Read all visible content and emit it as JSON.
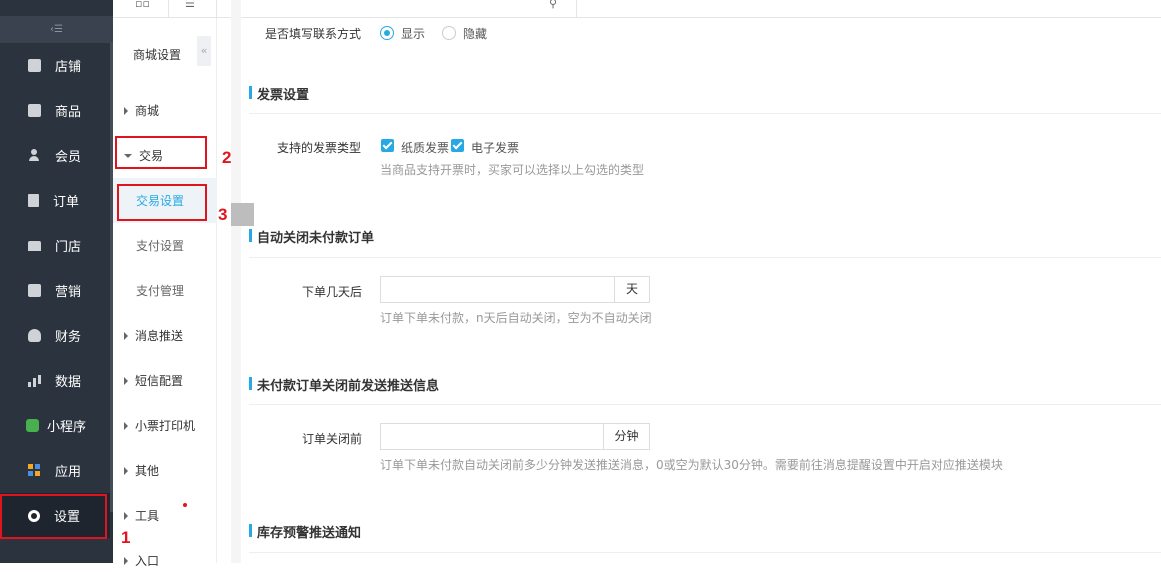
{
  "sidebar": {
    "collapse_icon": "menu-collapse-icon",
    "items": [
      {
        "label": "店铺",
        "icon": "store-icon"
      },
      {
        "label": "商品",
        "icon": "goods-icon"
      },
      {
        "label": "会员",
        "icon": "member-icon"
      },
      {
        "label": "订单",
        "icon": "order-icon"
      },
      {
        "label": "门店",
        "icon": "shop-icon"
      },
      {
        "label": "营销",
        "icon": "gift-icon"
      },
      {
        "label": "财务",
        "icon": "money-bag-icon"
      },
      {
        "label": "数据",
        "icon": "bar-chart-icon"
      },
      {
        "label": "小程序",
        "icon": "mini-program-icon"
      },
      {
        "label": "应用",
        "icon": "apps-grid-icon"
      },
      {
        "label": "设置",
        "icon": "gear-icon",
        "active": true
      }
    ]
  },
  "submenu": {
    "title": "商城设置",
    "fold_icon": "«",
    "items": [
      {
        "label": "商城",
        "type": "group"
      },
      {
        "label": "交易",
        "type": "group",
        "expanded": true
      },
      {
        "label": "交易设置",
        "type": "child",
        "selected": true
      },
      {
        "label": "支付设置",
        "type": "child"
      },
      {
        "label": "支付管理",
        "type": "child"
      },
      {
        "label": "消息推送",
        "type": "group"
      },
      {
        "label": "短信配置",
        "type": "group"
      },
      {
        "label": "小票打印机",
        "type": "group"
      },
      {
        "label": "其他",
        "type": "group"
      },
      {
        "label": "工具",
        "type": "group"
      },
      {
        "label": "入口",
        "type": "group"
      }
    ]
  },
  "annotations": [
    "1",
    "2",
    "3"
  ],
  "content": {
    "contact_row": {
      "label": "是否填写联系方式",
      "options": [
        "显示",
        "隐藏"
      ],
      "selected": "显示"
    },
    "invoice": {
      "title": "发票设置",
      "label": "支持的发票类型",
      "options": [
        "纸质发票",
        "电子发票"
      ],
      "hint": "当商品支持开票时，买家可以选择以上勾选的类型"
    },
    "auto_close": {
      "title": "自动关闭未付款订单",
      "label": "下单几天后",
      "value": "",
      "unit": "天",
      "hint": "订单下单未付款，n天后自动关闭，空为不自动关闭"
    },
    "close_notice": {
      "title": "未付款订单关闭前发送推送信息",
      "label": "订单关闭前",
      "value": "",
      "unit": "分钟",
      "hint": "订单下单未付款自动关闭前多少分钟发送推送消息，0或空为默认30分钟。需要前往消息提醒设置中开启对应推送模块"
    },
    "stock_alert": {
      "title": "库存预警推送通知"
    }
  },
  "colors": {
    "sidebar_bg": "#2b333e",
    "accent": "#27a9e3",
    "annotation_red": "#e0141e"
  }
}
